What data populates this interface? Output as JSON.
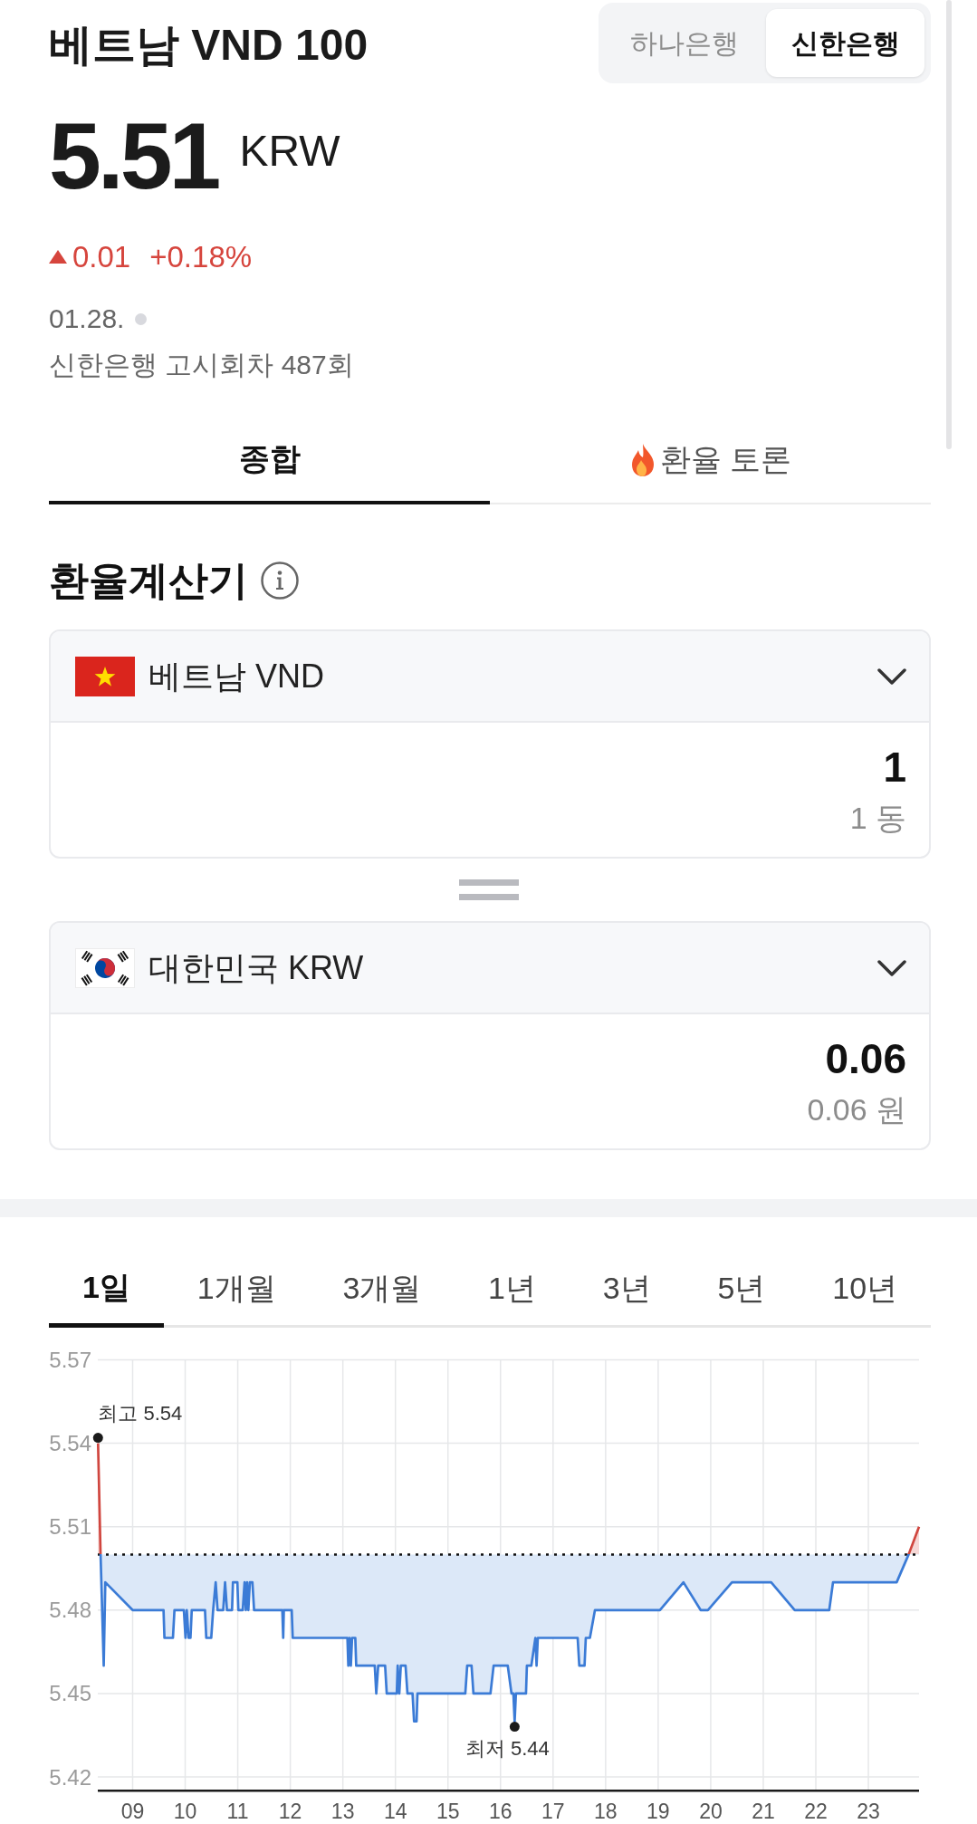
{
  "header": {
    "title": "베트남 VND 100",
    "bank_tabs": [
      {
        "label": "하나은행",
        "selected": false
      },
      {
        "label": "신한은행",
        "selected": true
      }
    ]
  },
  "quote": {
    "price": "5.51",
    "currency": "KRW",
    "change": {
      "rising": true,
      "amount": "0.01",
      "percent": "+0.18%"
    },
    "date": "01.28.",
    "live": false,
    "notice": "신한은행 고시회차 487회"
  },
  "tabs": [
    {
      "label": "종합",
      "selected": true,
      "hot": false
    },
    {
      "label": "환율 토론",
      "selected": false,
      "hot": true
    }
  ],
  "calculator": {
    "title": "환율계산기",
    "currencies": [
      {
        "kind": "vietnam",
        "label": "베트남 VND",
        "value": "1",
        "value_text": "1 동"
      },
      {
        "kind": "korea",
        "label": "대한민국 KRW",
        "value": "0.06",
        "value_text": "0.06 원"
      }
    ]
  },
  "chart": {
    "periods": [
      {
        "label": "1일",
        "selected": true
      },
      {
        "label": "1개월",
        "selected": false
      },
      {
        "label": "3개월",
        "selected": false
      },
      {
        "label": "1년",
        "selected": false
      },
      {
        "label": "3년",
        "selected": false
      },
      {
        "label": "5년",
        "selected": false
      },
      {
        "label": "10년",
        "selected": false
      }
    ],
    "chart_data": {
      "type": "area",
      "grid": true,
      "x": [
        8.342,
        8.39,
        8.45,
        8.48,
        9.0,
        9.588,
        9.605,
        9.767,
        9.796,
        9.975,
        10.006,
        10.03,
        10.065,
        10.101,
        10.125,
        10.377,
        10.401,
        10.496,
        10.532,
        10.58,
        10.616,
        10.723,
        10.759,
        10.795,
        10.892,
        10.909,
        10.993,
        11.011,
        11.095,
        11.13,
        11.154,
        11.178,
        11.202,
        11.231,
        11.279,
        11.311,
        11.848,
        11.865,
        11.877,
        12.027,
        12.046,
        13.087,
        13.104,
        13.128,
        13.152,
        13.176,
        13.237,
        13.254,
        13.607,
        13.636,
        13.673,
        13.804,
        13.835,
        14.026,
        14.043,
        14.074,
        14.103,
        14.193,
        14.229,
        14.326,
        14.355,
        14.403,
        14.42,
        15.33,
        15.366,
        15.449,
        15.485,
        15.809,
        15.869,
        16.138,
        16.209,
        16.245,
        16.269,
        16.293,
        16.485,
        16.502,
        16.586,
        16.664,
        16.686,
        16.71,
        17.468,
        17.499,
        17.599,
        17.623,
        17.701,
        17.797,
        19.033,
        19.481,
        19.808,
        19.946,
        20.404,
        21.15,
        21.598,
        22.255,
        22.327,
        23.538,
        23.766,
        23.964
      ],
      "values": [
        5.54,
        5.5,
        5.46,
        5.49,
        5.48,
        5.48,
        5.47,
        5.47,
        5.48,
        5.48,
        5.47,
        5.48,
        5.47,
        5.47,
        5.48,
        5.48,
        5.47,
        5.47,
        5.48,
        5.49,
        5.48,
        5.48,
        5.49,
        5.48,
        5.48,
        5.49,
        5.49,
        5.48,
        5.48,
        5.49,
        5.48,
        5.49,
        5.48,
        5.49,
        5.49,
        5.48,
        5.48,
        5.47,
        5.48,
        5.48,
        5.47,
        5.47,
        5.46,
        5.47,
        5.46,
        5.47,
        5.47,
        5.46,
        5.46,
        5.45,
        5.46,
        5.46,
        5.45,
        5.45,
        5.46,
        5.45,
        5.46,
        5.46,
        5.45,
        5.45,
        5.44,
        5.44,
        5.45,
        5.45,
        5.46,
        5.46,
        5.45,
        5.45,
        5.46,
        5.46,
        5.45,
        5.45,
        5.44,
        5.45,
        5.45,
        5.46,
        5.46,
        5.47,
        5.46,
        5.47,
        5.47,
        5.46,
        5.46,
        5.47,
        5.47,
        5.48,
        5.48,
        5.49,
        5.48,
        5.48,
        5.49,
        5.49,
        5.48,
        5.48,
        5.49,
        5.49,
        5.5,
        5.51
      ],
      "xlim": [
        8.337,
        23.964
      ],
      "ylim": [
        5.415,
        5.57
      ],
      "xticks": [
        {
          "value": 9,
          "label": "09"
        },
        {
          "value": 10,
          "label": "10"
        },
        {
          "value": 11,
          "label": "11"
        },
        {
          "value": 12,
          "label": "12"
        },
        {
          "value": 13,
          "label": "13"
        },
        {
          "value": 14,
          "label": "14"
        },
        {
          "value": 15,
          "label": "15"
        },
        {
          "value": 16,
          "label": "16"
        },
        {
          "value": 17,
          "label": "17"
        },
        {
          "value": 18,
          "label": "18"
        },
        {
          "value": 19,
          "label": "19"
        },
        {
          "value": 20,
          "label": "20"
        },
        {
          "value": 21,
          "label": "21"
        },
        {
          "value": 22,
          "label": "22"
        },
        {
          "value": 23,
          "label": "23"
        }
      ],
      "yticks": [
        5.42,
        5.45,
        5.48,
        5.51,
        5.54,
        5.57
      ],
      "ref_lines": [
        {
          "axis": "y",
          "value": 5.5
        }
      ],
      "annotations": [
        {
          "text": "최고 5.54",
          "x": 8.342,
          "y": 5.54
        },
        {
          "text": "최저 5.44",
          "x": 16.269,
          "y": 5.44
        }
      ]
    }
  }
}
